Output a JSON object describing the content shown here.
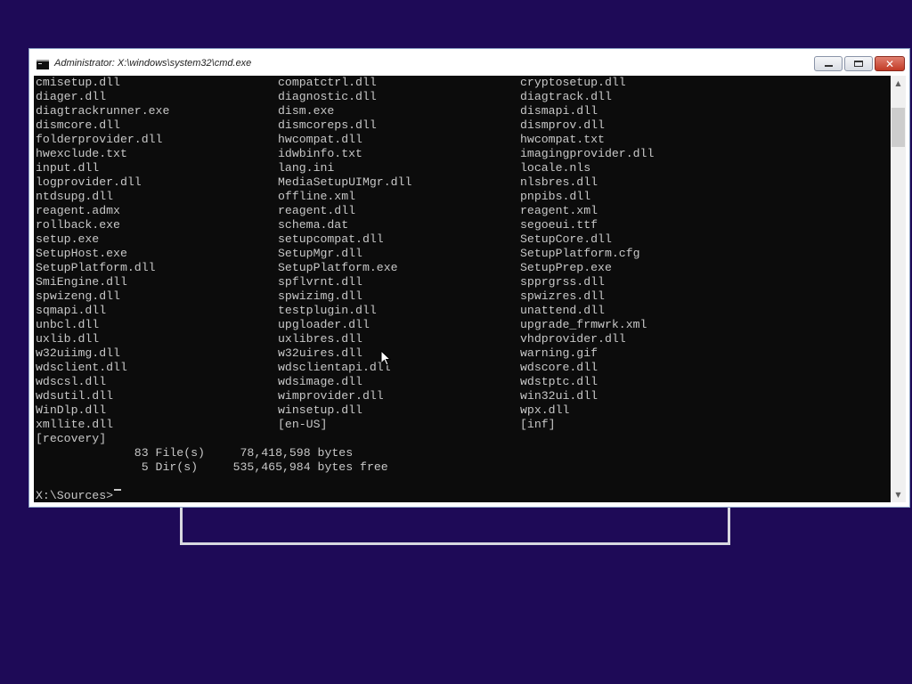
{
  "window": {
    "title": "Administrator: X:\\windows\\system32\\cmd.exe"
  },
  "console": {
    "rows": [
      [
        "cmisetup.dll",
        "compatctrl.dll",
        "cryptosetup.dll"
      ],
      [
        "diager.dll",
        "diagnostic.dll",
        "diagtrack.dll"
      ],
      [
        "diagtrackrunner.exe",
        "dism.exe",
        "dismapi.dll"
      ],
      [
        "dismcore.dll",
        "dismcoreps.dll",
        "dismprov.dll"
      ],
      [
        "folderprovider.dll",
        "hwcompat.dll",
        "hwcompat.txt"
      ],
      [
        "hwexclude.txt",
        "idwbinfo.txt",
        "imagingprovider.dll"
      ],
      [
        "input.dll",
        "lang.ini",
        "locale.nls"
      ],
      [
        "logprovider.dll",
        "MediaSetupUIMgr.dll",
        "nlsbres.dll"
      ],
      [
        "ntdsupg.dll",
        "offline.xml",
        "pnpibs.dll"
      ],
      [
        "reagent.admx",
        "reagent.dll",
        "reagent.xml"
      ],
      [
        "rollback.exe",
        "schema.dat",
        "segoeui.ttf"
      ],
      [
        "setup.exe",
        "setupcompat.dll",
        "SetupCore.dll"
      ],
      [
        "SetupHost.exe",
        "SetupMgr.dll",
        "SetupPlatform.cfg"
      ],
      [
        "SetupPlatform.dll",
        "SetupPlatform.exe",
        "SetupPrep.exe"
      ],
      [
        "SmiEngine.dll",
        "spflvrnt.dll",
        "spprgrss.dll"
      ],
      [
        "spwizeng.dll",
        "spwizimg.dll",
        "spwizres.dll"
      ],
      [
        "sqmapi.dll",
        "testplugin.dll",
        "unattend.dll"
      ],
      [
        "unbcl.dll",
        "upgloader.dll",
        "upgrade_frmwrk.xml"
      ],
      [
        "uxlib.dll",
        "uxlibres.dll",
        "vhdprovider.dll"
      ],
      [
        "w32uiimg.dll",
        "w32uires.dll",
        "warning.gif"
      ],
      [
        "wdsclient.dll",
        "wdsclientapi.dll",
        "wdscore.dll"
      ],
      [
        "wdscsl.dll",
        "wdsimage.dll",
        "wdstptc.dll"
      ],
      [
        "wdsutil.dll",
        "wimprovider.dll",
        "win32ui.dll"
      ],
      [
        "WinDlp.dll",
        "winsetup.dll",
        "wpx.dll"
      ],
      [
        "xmllite.dll",
        "[en-US]",
        "[inf]"
      ],
      [
        "[recovery]",
        "",
        ""
      ]
    ],
    "summary_files": "              83 File(s)     78,418,598 bytes",
    "summary_dirs": "               5 Dir(s)     535,465,984 bytes free",
    "blank": "",
    "prompt": "X:\\Sources>"
  },
  "colors": {
    "desktop": "#1e0a57",
    "console_bg": "#0c0c0c",
    "console_fg": "#c8c8c8",
    "close_button": "#c23b26"
  },
  "icons": {
    "app": "cmd-app-icon",
    "minimize": "minimize-icon",
    "maximize": "maximize-icon",
    "close": "close-icon",
    "scroll_up": "scroll-up-arrow-icon",
    "scroll_down": "scroll-down-arrow-icon",
    "mouse": "mouse-pointer-icon"
  }
}
